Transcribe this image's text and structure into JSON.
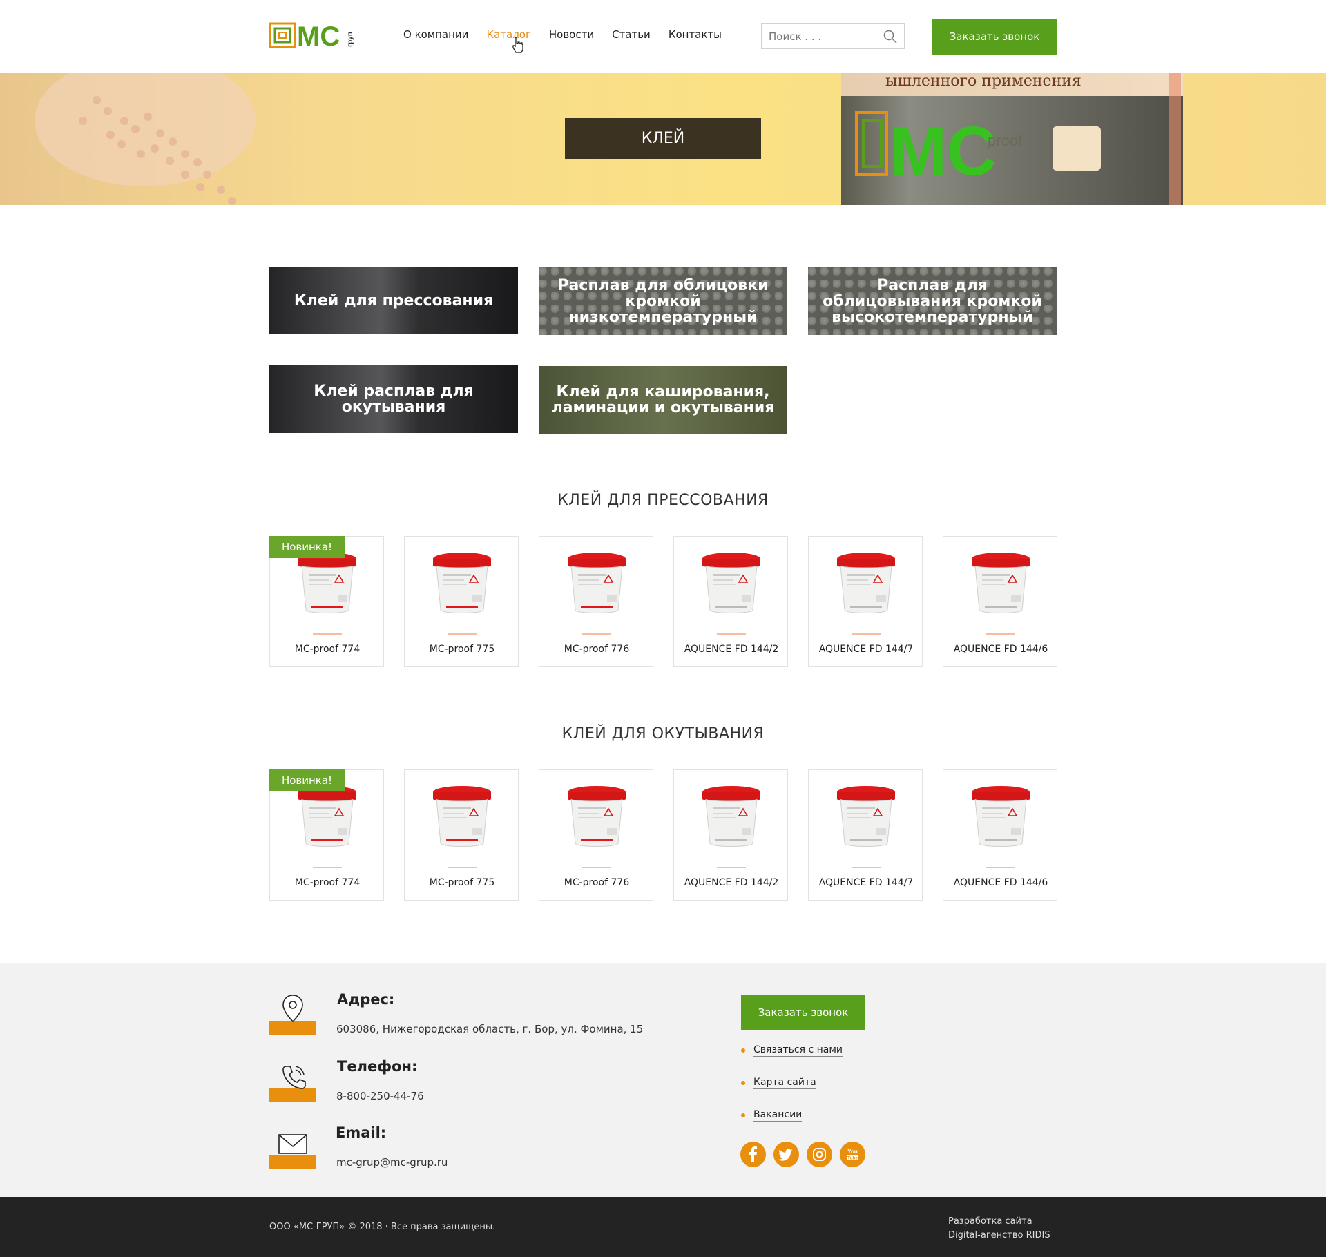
{
  "header": {
    "nav": [
      "О компании",
      "Каталог",
      "Новости",
      "Статьи",
      "Контакты"
    ],
    "search_placeholder": "Поиск . . .",
    "call_button": "Заказать звонок",
    "logo_suffix": "груп"
  },
  "hero": {
    "title": "КЛЕЙ",
    "bucket_text": "ышленного применения",
    "bucket_mark": "proof"
  },
  "categories": [
    "Клей для прессования",
    "Расплав для облицовки кромкой низкотемпературный",
    "Расплав для облицовывания кромкой высокотемпературный",
    "Клей расплав для окутывания",
    "Клей для каширования, ламинации  и окутывания"
  ],
  "sections": [
    {
      "title": "КЛЕЙ ДЛЯ ПРЕССОВАНИЯ",
      "badge": "Новинка!",
      "products": [
        "MC-proof 774",
        "MC-proof 775",
        "MC-proof 776",
        "AQUENCE FD 144/2",
        "AQUENCE FD 144/7",
        "AQUENCE FD 144/6"
      ]
    },
    {
      "title": "КЛЕЙ ДЛЯ ОКУТЫВАНИЯ",
      "badge": "Новинка!",
      "products": [
        "MC-proof 774",
        "MC-proof 775",
        "MC-proof 776",
        "AQUENCE FD 144/2",
        "AQUENCE FD 144/7",
        "AQUENCE FD 144/6"
      ]
    }
  ],
  "footer": {
    "address_label": "Адрес:",
    "address": "603086, Нижегородская область, г. Бор, ул. Фомина, 15",
    "phone_label": "Телефон:",
    "phone": "8-800-250-44-76",
    "email_label": "Email:",
    "email": "mc-grup@mc-grup.ru",
    "call_button": "Заказать звонок",
    "links": [
      "Связаться с нами",
      "Карта сайта",
      "Вакансии"
    ],
    "social": [
      "facebook-icon",
      "twitter-icon",
      "instagram-icon",
      "youtube-icon"
    ]
  },
  "bottom": {
    "copyright": "ООО «МС-ГРУП» © 2018 · Все права защищены.",
    "dev_line1": "Разработка сайта",
    "dev_line2": "Digital-агенство RIDIS"
  },
  "colors": {
    "accent_green": "#58a01c",
    "accent_orange": "#e8900e",
    "hero_title_bg": "#3c3222",
    "bottom_bg": "#232323"
  }
}
